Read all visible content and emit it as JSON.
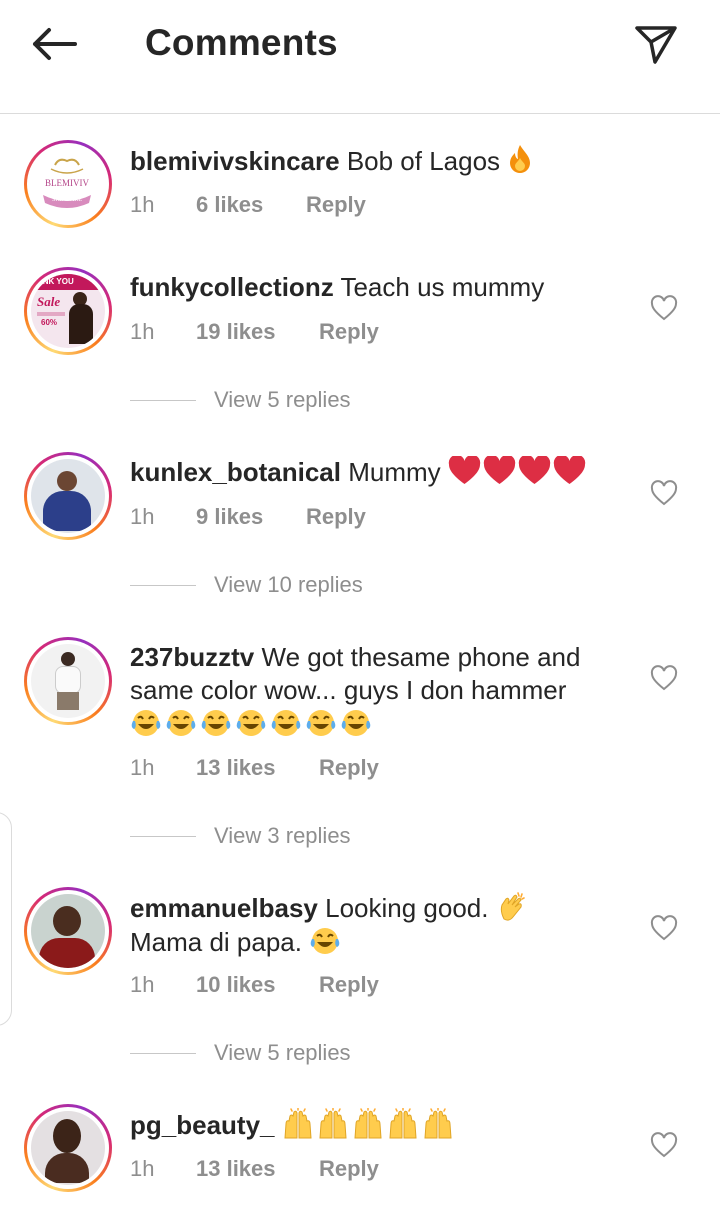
{
  "header": {
    "title": "Comments"
  },
  "icons": {
    "back": "arrow-left-icon",
    "share": "paper-plane-icon",
    "like": "heart-outline-icon"
  },
  "colors": {
    "text": "#262626",
    "secondary": "#8e8e8e",
    "divider": "#dbdbdb",
    "ring_start": "#feda75",
    "ring_end": "#d62976"
  },
  "comments": [
    {
      "username": "blemivivskincare",
      "text": "Bob of Lagos",
      "emoji": "fire",
      "time": "1h",
      "likes": "6 likes",
      "reply": "Reply"
    },
    {
      "username": "funkycollectionz",
      "text": "Teach us mummy",
      "time": "1h",
      "likes": "19 likes",
      "reply": "Reply",
      "view_replies": "View 5 replies"
    },
    {
      "username": "kunlex_botanical",
      "text": "Mummy",
      "emoji": "red-heart x4",
      "time": "1h",
      "likes": "9 likes",
      "reply": "Reply",
      "view_replies": "View 10 replies"
    },
    {
      "username": "237buzztv",
      "text": "We got thesame phone and same color wow... guys I don hammer",
      "emoji": "tears-of-joy x7",
      "time": "1h",
      "likes": "13 likes",
      "reply": "Reply",
      "view_replies": "View 3 replies"
    },
    {
      "username": "emmanuelbasy",
      "text": "Looking good.",
      "text2": "Mama di papa.",
      "emoji": "clapping-hands, tears-of-joy",
      "time": "1h",
      "likes": "10 likes",
      "reply": "Reply",
      "view_replies": "View 5 replies"
    },
    {
      "username": "pg_beauty_",
      "text": "",
      "emoji": "raising-hands x5",
      "time": "1h",
      "likes": "13 likes",
      "reply": "Reply"
    }
  ],
  "avatar_texts": {
    "blemiviv": "BLEMIVIV",
    "skincare": "SKINCARE",
    "thank_you": "ANK YOU",
    "sale": "Sale",
    "percent": "60%"
  }
}
